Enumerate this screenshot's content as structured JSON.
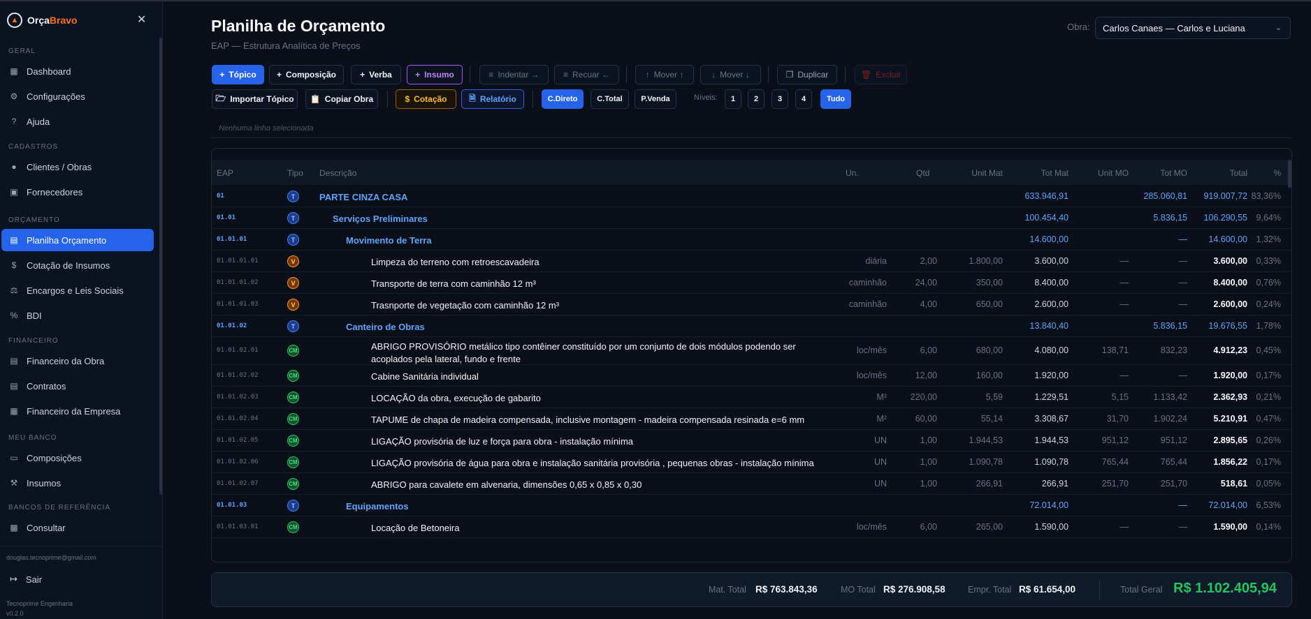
{
  "app": {
    "brand_a": "Orça",
    "brand_b": "Bravo"
  },
  "sidebar": {
    "sections": [
      {
        "label": "Geral",
        "items": [
          {
            "label": "Dashboard",
            "icon": "dashboard-icon"
          },
          {
            "label": "Configurações",
            "icon": "gear-icon"
          },
          {
            "label": "Ajuda",
            "icon": "help-icon"
          }
        ]
      },
      {
        "label": "Cadastros",
        "items": [
          {
            "label": "Clientes / Obras",
            "icon": "users-icon"
          },
          {
            "label": "Fornecedores",
            "icon": "truck-icon"
          }
        ]
      },
      {
        "label": "Orçamento",
        "items": [
          {
            "label": "Planilha Orçamento",
            "icon": "sheet-icon",
            "active": true
          },
          {
            "label": "Cotação de Insumos",
            "icon": "dollar-icon"
          },
          {
            "label": "Encargos e Leis Sociais",
            "icon": "scale-icon"
          },
          {
            "label": "BDI",
            "icon": "percent-icon"
          }
        ]
      },
      {
        "label": "Financeiro",
        "items": [
          {
            "label": "Financeiro da Obra",
            "icon": "file-icon"
          },
          {
            "label": "Contratos",
            "icon": "contract-icon"
          },
          {
            "label": "Financeiro da Empresa",
            "icon": "building-icon"
          }
        ]
      },
      {
        "label": "Meu Banco",
        "items": [
          {
            "label": "Composições",
            "icon": "book-icon"
          },
          {
            "label": "Insumos",
            "icon": "wrench-icon"
          }
        ]
      },
      {
        "label": "Bancos de Referência",
        "items": [
          {
            "label": "Consultar",
            "icon": "database-icon"
          }
        ]
      }
    ],
    "user_email": "douglas.tecnoprime@gmail.com",
    "logout_label": "Sair",
    "company": "Tecnoprime Engenharia",
    "version": "v0.2.0"
  },
  "header": {
    "title": "Planilha de Orçamento",
    "subtitle": "EAP — Estrutura Analítica de Preços",
    "obra_label": "Obra:",
    "obra_value": "Carlos Canaes — Carlos e Luciana"
  },
  "toolbar": {
    "topico": "Tópico",
    "composicao": "Composição",
    "verba": "Verba",
    "insumo": "Insumo",
    "indentar": "Indentar →",
    "recuar": "Recuar ←",
    "mover_up": "Mover ↑",
    "mover_down": "Mover ↓",
    "duplicar": "Duplicar",
    "excluir": "Excluir",
    "importar": "Importar Tópico",
    "copiar": "Copiar Obra",
    "cotacao": "Cotação",
    "relatorio": "Relatório",
    "cdireto": "C.Direto",
    "ctotal": "C.Total",
    "pvenda": "P.Venda",
    "niveis": "Níveis:",
    "n1": "1",
    "n2": "2",
    "n3": "3",
    "n4": "4",
    "tudo": "Tudo",
    "selection_status": "Nenhuma linha selecionada"
  },
  "table": {
    "headers": {
      "eap": "EAP",
      "tipo": "Tipo",
      "desc": "Descrição",
      "un": "Un.",
      "qtd": "Qtd",
      "unit_mat": "Unit Mat",
      "tot_mat": "Tot Mat",
      "unit_mo": "Unit MO",
      "tot_mo": "Tot MO",
      "total": "Total",
      "pct": "%"
    },
    "rows": [
      {
        "eap": "01",
        "tipo": "T",
        "level": 0,
        "desc": "PARTE CINZA CASA",
        "un": "",
        "qtd": "",
        "unit_mat": "",
        "tot_mat": "633.946,91",
        "unit_mo": "",
        "tot_mo": "285.060,81",
        "total": "919.007,72",
        "pct": "83,36%"
      },
      {
        "eap": "01.01",
        "tipo": "T",
        "level": 1,
        "desc": "Serviços Preliminares",
        "un": "",
        "qtd": "",
        "unit_mat": "",
        "tot_mat": "100.454,40",
        "unit_mo": "",
        "tot_mo": "5.836,15",
        "total": "106.290,55",
        "pct": "9,64%"
      },
      {
        "eap": "01.01.01",
        "tipo": "T",
        "level": 2,
        "desc": "Movimento de Terra",
        "un": "",
        "qtd": "",
        "unit_mat": "",
        "tot_mat": "14.600,00",
        "unit_mo": "",
        "tot_mo": "—",
        "total": "14.600,00",
        "pct": "1,32%"
      },
      {
        "eap": "01.01.01.01",
        "tipo": "V",
        "level": 3,
        "desc": "Limpeza do terreno com retroescavadeira",
        "un": "diária",
        "qtd": "2,00",
        "unit_mat": "1.800,00",
        "tot_mat": "3.600,00",
        "unit_mo": "—",
        "tot_mo": "—",
        "total": "3.600,00",
        "pct": "0,33%"
      },
      {
        "eap": "01.01.01.02",
        "tipo": "V",
        "level": 3,
        "desc": "Transporte de terra com caminhão 12 m³",
        "un": "caminhão",
        "qtd": "24,00",
        "unit_mat": "350,00",
        "tot_mat": "8.400,00",
        "unit_mo": "—",
        "tot_mo": "—",
        "total": "8.400,00",
        "pct": "0,76%"
      },
      {
        "eap": "01.01.01.03",
        "tipo": "V",
        "level": 3,
        "desc": "Trasnporte de vegetação com caminhão 12 m³",
        "un": "caminhão",
        "qtd": "4,00",
        "unit_mat": "650,00",
        "tot_mat": "2.600,00",
        "unit_mo": "—",
        "tot_mo": "—",
        "total": "2.600,00",
        "pct": "0,24%"
      },
      {
        "eap": "01.01.02",
        "tipo": "T",
        "level": 2,
        "desc": "Canteiro de Obras",
        "un": "",
        "qtd": "",
        "unit_mat": "",
        "tot_mat": "13.840,40",
        "unit_mo": "",
        "tot_mo": "5.836,15",
        "total": "19.676,55",
        "pct": "1,78%"
      },
      {
        "eap": "01.01.02.01",
        "tipo": "CM",
        "level": 3,
        "desc": "ABRIGO PROVISÓRIO metálico tipo contêiner constituído por um conjunto de dois módulos podendo ser",
        "desc2": "acoplados pela lateral, fundo e frente",
        "un": "loc/mês",
        "qtd": "6,00",
        "unit_mat": "680,00",
        "tot_mat": "4.080,00",
        "unit_mo": "138,71",
        "tot_mo": "832,23",
        "total": "4.912,23",
        "pct": "0,45%"
      },
      {
        "eap": "01.01.02.02",
        "tipo": "CM",
        "level": 3,
        "desc": "Cabine Sanitária individual",
        "un": "loc/mês",
        "qtd": "12,00",
        "unit_mat": "160,00",
        "tot_mat": "1.920,00",
        "unit_mo": "—",
        "tot_mo": "—",
        "total": "1.920,00",
        "pct": "0,17%"
      },
      {
        "eap": "01.01.02.03",
        "tipo": "CM",
        "level": 3,
        "desc": "LOCAÇÃO da obra, execução de gabarito",
        "un": "M²",
        "qtd": "220,00",
        "unit_mat": "5,59",
        "tot_mat": "1.229,51",
        "unit_mo": "5,15",
        "tot_mo": "1.133,42",
        "total": "2.362,93",
        "pct": "0,21%"
      },
      {
        "eap": "01.01.02.04",
        "tipo": "CM",
        "level": 3,
        "desc": "TAPUME de chapa de madeira compensada, inclusive montagem - madeira compensada resinada e=6 mm",
        "un": "M²",
        "qtd": "60,00",
        "unit_mat": "55,14",
        "tot_mat": "3.308,67",
        "unit_mo": "31,70",
        "tot_mo": "1.902,24",
        "total": "5.210,91",
        "pct": "0,47%"
      },
      {
        "eap": "01.01.02.05",
        "tipo": "CM",
        "level": 3,
        "desc": "LIGAÇÃO provisória de luz e força para obra - instalação mínima",
        "un": "UN",
        "qtd": "1,00",
        "unit_mat": "1.944,53",
        "tot_mat": "1.944,53",
        "unit_mo": "951,12",
        "tot_mo": "951,12",
        "total": "2.895,65",
        "pct": "0,26%"
      },
      {
        "eap": "01.01.02.06",
        "tipo": "CM",
        "level": 3,
        "desc": "LIGAÇÃO provisória de água para obra e instalação sanitária provisória , pequenas obras - instalação mínima",
        "un": "UN",
        "qtd": "1,00",
        "unit_mat": "1.090,78",
        "tot_mat": "1.090,78",
        "unit_mo": "765,44",
        "tot_mo": "765,44",
        "total": "1.856,22",
        "pct": "0,17%"
      },
      {
        "eap": "01.01.02.07",
        "tipo": "CM",
        "level": 3,
        "desc": "ABRIGO para cavalete em alvenaria, dimensões 0,65 x 0,85 x 0,30",
        "un": "UN",
        "qtd": "1,00",
        "unit_mat": "266,91",
        "tot_mat": "266,91",
        "unit_mo": "251,70",
        "tot_mo": "251,70",
        "total": "518,61",
        "pct": "0,05%"
      },
      {
        "eap": "01.01.03",
        "tipo": "T",
        "level": 2,
        "desc": "Equipamentos",
        "un": "",
        "qtd": "",
        "unit_mat": "",
        "tot_mat": "72.014,00",
        "unit_mo": "",
        "tot_mo": "—",
        "total": "72.014,00",
        "pct": "6,53%"
      },
      {
        "eap": "01.01.03.01",
        "tipo": "CM",
        "level": 3,
        "desc": "Locação de Betoneira",
        "un": "loc/mês",
        "qtd": "6,00",
        "unit_mat": "265,00",
        "tot_mat": "1.590,00",
        "unit_mo": "—",
        "tot_mo": "—",
        "total": "1.590,00",
        "pct": "0,14%"
      }
    ]
  },
  "totals": {
    "mat_label": "Mat. Total",
    "mat_value": "R$ 763.843,36",
    "mo_label": "MO Total",
    "mo_value": "R$ 276.908,58",
    "empr_label": "Empr. Total",
    "empr_value": "R$ 61.654,00",
    "geral_label": "Total Geral",
    "geral_value": "R$ 1.102.405,94"
  }
}
